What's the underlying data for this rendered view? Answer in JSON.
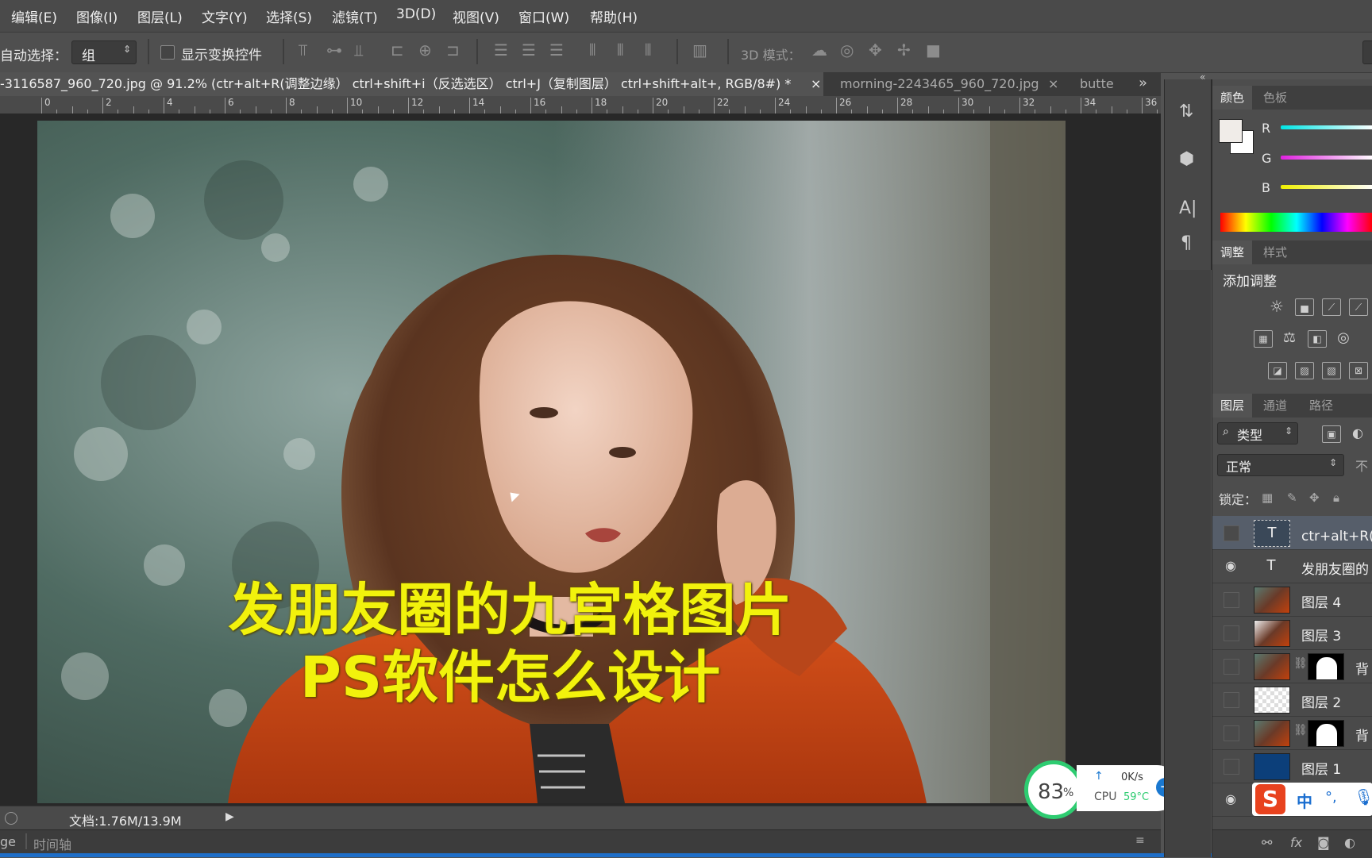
{
  "menu": [
    "编辑(E)",
    "图像(I)",
    "图层(L)",
    "文字(Y)",
    "选择(S)",
    "滤镜(T)",
    "3D(D)",
    "视图(V)",
    "窗口(W)",
    "帮助(H)"
  ],
  "options": {
    "auto_select_label": "自动选择：",
    "auto_select_value": "组",
    "show_transform_label": "显示变换控件",
    "mode_3d_label": "3D 模式："
  },
  "tabs": {
    "active": "-3116587_960_720.jpg @ 91.2% (ctr+alt+R(调整边缘） ctrl+shift+i（反选选区） ctrl+J（复制图层） ctrl+shift+alt+, RGB/8#) *",
    "tab2": "morning-2243465_960_720.jpg",
    "tab3": "butte",
    "close": "×",
    "overflow": "»"
  },
  "ruler": [
    "0",
    "2",
    "4",
    "6",
    "8",
    "10",
    "12",
    "14",
    "16",
    "18",
    "20",
    "22",
    "24",
    "26",
    "28",
    "30",
    "32",
    "34",
    "36"
  ],
  "overlay": {
    "line1": "发朋友圈的九宫格图片",
    "line2": "PS软件怎么设计"
  },
  "status": {
    "doc": "文档:1.76M/13.9M",
    "left_label": "ge",
    "timeline": "时间轴"
  },
  "panels": {
    "color_tab": "颜色",
    "swatch_tab": "色板",
    "r": "R",
    "g": "G",
    "b": "B",
    "adjust_tab": "调整",
    "style_tab": "样式",
    "add_adjust": "添加调整",
    "layers_tab": "图层",
    "channels_tab": "通道",
    "paths_tab": "路径",
    "kind": "类型",
    "blend": "正常",
    "opacity_prefix": "不",
    "lock": "锁定："
  },
  "layers": [
    {
      "name": "ctr+alt+R(调",
      "type": "text",
      "visible": false
    },
    {
      "name": "发朋友圈的",
      "type": "text",
      "visible": true
    },
    {
      "name": "图层 4",
      "type": "photo",
      "visible": false
    },
    {
      "name": "图层 3",
      "type": "photo",
      "visible": false
    },
    {
      "name": "背",
      "type": "photo-mask",
      "visible": false
    },
    {
      "name": "图层 2",
      "type": "transparent",
      "visible": false
    },
    {
      "name": "背",
      "type": "photo-mask",
      "visible": false
    },
    {
      "name": "图层 1",
      "type": "blue",
      "visible": false
    },
    {
      "name": "",
      "type": "photo",
      "visible": true
    }
  ],
  "widget": {
    "percent": "83",
    "percent_sign": "%",
    "speed": "0K/s",
    "cpu_label": "CPU",
    "cpu_temp": "59°C"
  },
  "ime": {
    "s": "S",
    "zh": "中",
    "punct": "°,"
  },
  "colors": {
    "overlay_text": "#f2f20c",
    "coat": "#c2410c",
    "widget_green": "#2ecc71"
  }
}
